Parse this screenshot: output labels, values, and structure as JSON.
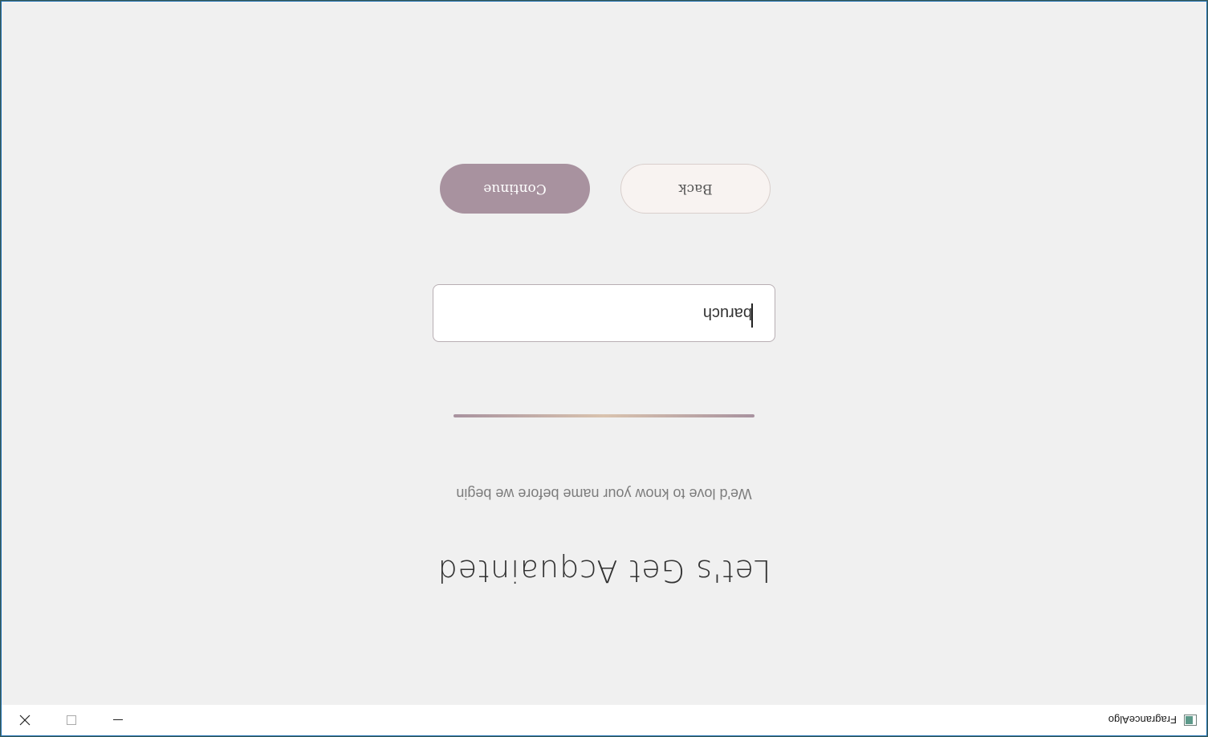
{
  "window": {
    "title": "FragranceAlgo",
    "icon": "app-window-icon",
    "controls": {
      "minimize_icon": "minimize-icon",
      "maximize_icon": "maximize-icon",
      "close_icon": "close-icon"
    }
  },
  "onboarding": {
    "heading": "Let's Get Acquainted",
    "subheading": "We'd love to know your name before we begin",
    "name_input": {
      "value": "baruch",
      "placeholder": ""
    },
    "buttons": {
      "back_label": "Back",
      "continue_label": "Continue"
    }
  },
  "colors": {
    "accent": "#a8929f",
    "accent_light": "#d9c3ae",
    "background": "#f0f0f0",
    "back_button_bg": "#f8f3f1"
  },
  "orientation": "upside-down (rotated 180 degrees)"
}
